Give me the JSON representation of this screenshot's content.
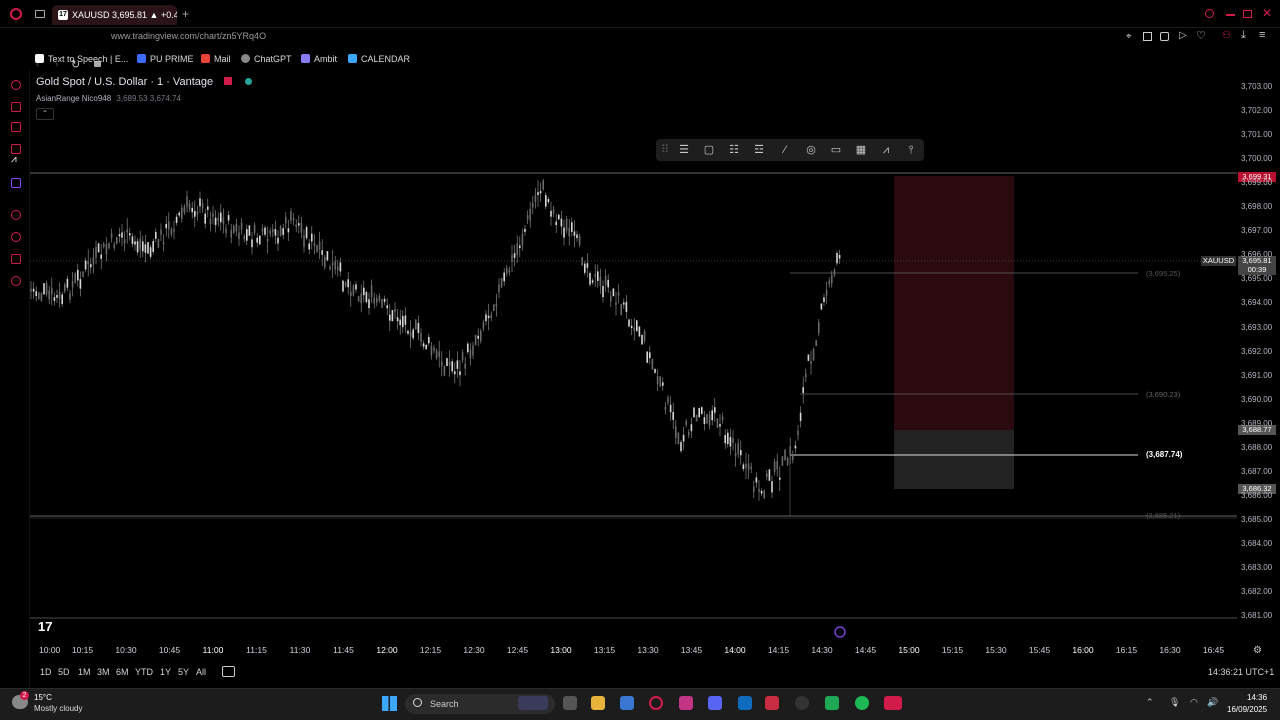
{
  "browser": {
    "tab_title": "XAUUSD 3,695.81 ▲ +0.4",
    "url": "www.tradingview.com/chart/zn5YRq4O",
    "bookmarks": [
      {
        "label": "Text to Speech | E...",
        "color": "#ffffff"
      },
      {
        "label": "PU PRIME",
        "color": "#3b6cff"
      },
      {
        "label": "Mail",
        "color": "#ea4335"
      },
      {
        "label": "ChatGPT",
        "color": "#cccccc"
      },
      {
        "label": "Ambit",
        "color": "#8a7cff"
      },
      {
        "label": "CALENDAR",
        "color": "#3ba7ff"
      }
    ]
  },
  "chart": {
    "title": "Gold Spot / U.S. Dollar · 1 · Vantage",
    "indicator_name": "AsianRange Nico948",
    "indicator_values": "3,689.53  3,674.74",
    "symbol_badge": "XAUUSD",
    "countdown": "00:39",
    "price_ticks": [
      "3,703.00",
      "3,702.00",
      "3,701.00",
      "3,700.00",
      "3,699.00",
      "3,698.00",
      "3,697.00",
      "3,696.00",
      "3,695.00",
      "3,694.00",
      "3,693.00",
      "3,692.00",
      "3,691.00",
      "3,690.00",
      "3,689.00",
      "3,688.00",
      "3,687.00",
      "3,686.00",
      "3,685.00",
      "3,684.00",
      "3,683.00",
      "3,682.00",
      "3,681.00"
    ],
    "price_labels": {
      "stop": "3,699.31",
      "current": "3,695.81",
      "entry": "3,688.77",
      "target": "3,686.32"
    },
    "level_labels": {
      "l1": "(3,695.25)",
      "l2": "(3,690.23)",
      "l3": "(3,687.74)",
      "l4": "(3,685.21)"
    },
    "time_ticks": [
      "10:00",
      "10:15",
      "10:30",
      "10:45",
      "11:00",
      "11:15",
      "11:30",
      "11:45",
      "12:00",
      "12:15",
      "12:30",
      "12:45",
      "13:00",
      "13:15",
      "13:30",
      "13:45",
      "14:00",
      "14:15",
      "14:30",
      "14:45",
      "15:00",
      "15:15",
      "15:30",
      "15:45",
      "16:00",
      "16:15",
      "16:30",
      "16:45"
    ],
    "bold_times": [
      "11:00",
      "12:00",
      "13:00",
      "14:00",
      "15:00",
      "16:00"
    ]
  },
  "ranges": [
    "1D",
    "5D",
    "1M",
    "3M",
    "6M",
    "YTD",
    "1Y",
    "5Y",
    "All"
  ],
  "clock": "14:36:21 UTC+1",
  "taskbar": {
    "weather_temp": "15°C",
    "weather_desc": "Mostly cloudy",
    "search_placeholder": "Search",
    "time": "14:36",
    "date": "16/09/2025",
    "notif_count": "2"
  },
  "colors": {
    "accent": "#d11b4b",
    "stop_zone": "#2a0a0e",
    "target_zone": "#222222",
    "candle": "#c8c8c8"
  }
}
